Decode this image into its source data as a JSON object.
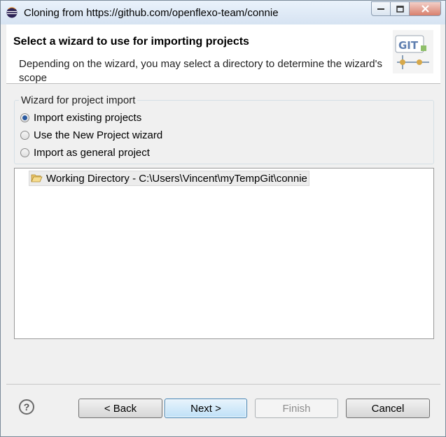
{
  "window": {
    "title": "Cloning from https://github.com/openflexo-team/connie"
  },
  "header": {
    "title": "Select a wizard to use for importing projects",
    "description": "Depending on the wizard, you may select a directory to determine the wizard's scope",
    "logo_text": "GIT"
  },
  "wizard_group": {
    "label": "Wizard for project import",
    "options": [
      {
        "label": "Import existing projects",
        "selected": true
      },
      {
        "label": "Use the New Project wizard",
        "selected": false
      },
      {
        "label": "Import as general project",
        "selected": false
      }
    ]
  },
  "tree": {
    "items": [
      {
        "label": "Working Directory - C:\\Users\\Vincent\\myTempGit\\connie",
        "icon": "folder-open-icon"
      }
    ]
  },
  "buttons": {
    "back": "< Back",
    "next": "Next >",
    "finish": "Finish",
    "cancel": "Cancel",
    "help": "?"
  },
  "colors": {
    "accent": "#3c7fb1",
    "radio_selected": "#2a5aa0"
  }
}
